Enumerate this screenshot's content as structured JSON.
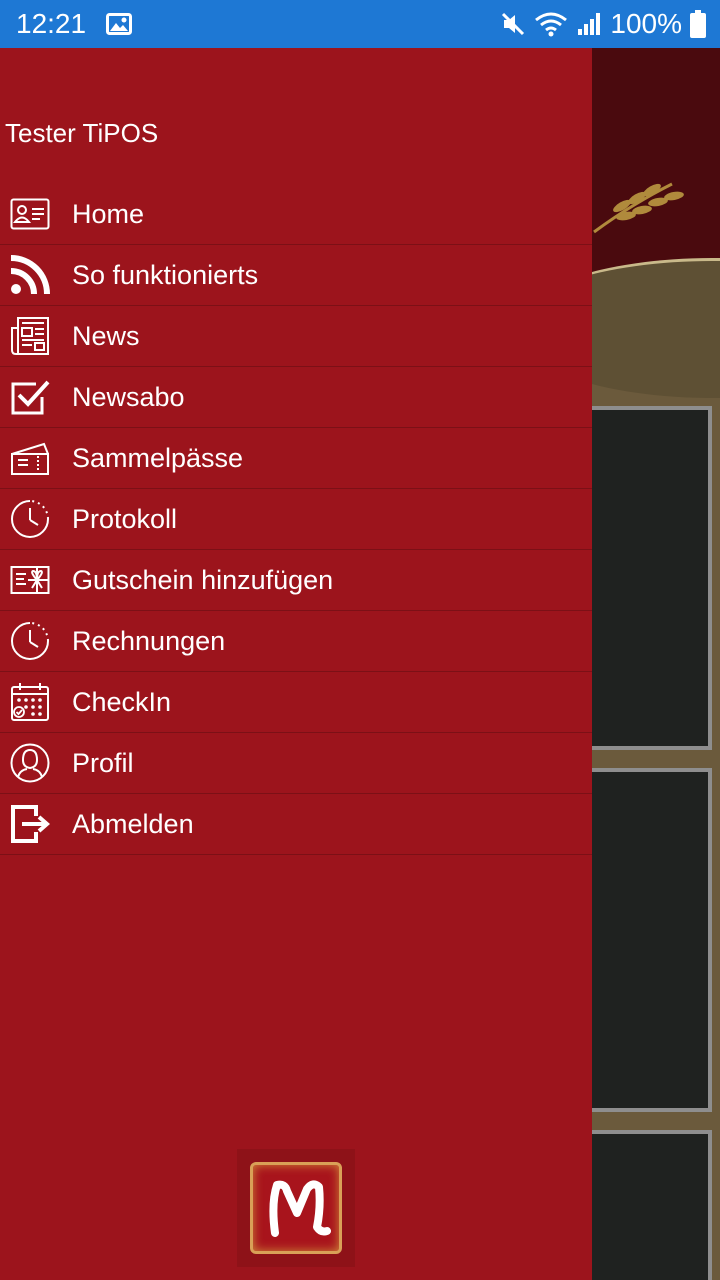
{
  "status_bar": {
    "time": "12:21",
    "battery": "100%"
  },
  "drawer": {
    "user_name": "Tester TiPOS",
    "items": [
      {
        "label": "Home",
        "icon": "id-card-icon"
      },
      {
        "label": "So funktionierts",
        "icon": "rss-icon"
      },
      {
        "label": "News",
        "icon": "newspaper-icon"
      },
      {
        "label": "Newsabo",
        "icon": "checkbox-icon"
      },
      {
        "label": "Sammelpässe",
        "icon": "tickets-icon"
      },
      {
        "label": "Protokoll",
        "icon": "clock-history-icon"
      },
      {
        "label": "Gutschein hinzufügen",
        "icon": "voucher-icon"
      },
      {
        "label": "Rechnungen",
        "icon": "clock-history-icon"
      },
      {
        "label": "CheckIn",
        "icon": "calendar-check-icon"
      },
      {
        "label": "Profil",
        "icon": "user-icon"
      },
      {
        "label": "Abmelden",
        "icon": "logout-icon"
      }
    ],
    "logo_letter": "M"
  },
  "colors": {
    "status_bar": "#1e78d4",
    "drawer_bg": "#9c141c",
    "divider": "#7c1016"
  }
}
